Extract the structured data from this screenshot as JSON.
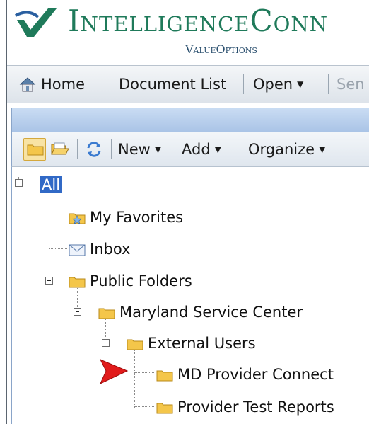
{
  "header": {
    "title": "IntelligenceConn",
    "subtitle": "ValueOptions"
  },
  "toolbar": {
    "home": "Home",
    "document_list": "Document List",
    "open": "Open",
    "send": "Sen"
  },
  "toolbar2": {
    "new": "New",
    "add": "Add",
    "organize": "Organize"
  },
  "tree": {
    "root": "All",
    "items": [
      {
        "label": "My Favorites",
        "icon": "favorites-folder-icon"
      },
      {
        "label": "Inbox",
        "icon": "inbox-envelope-icon"
      },
      {
        "label": "Public Folders",
        "icon": "folder-icon"
      },
      {
        "label": "Maryland Service Center",
        "icon": "folder-icon"
      },
      {
        "label": "External Users",
        "icon": "folder-icon"
      },
      {
        "label": "MD Provider Connect",
        "icon": "folder-icon"
      },
      {
        "label": "Provider Test Reports",
        "icon": "folder-icon"
      }
    ]
  },
  "colors": {
    "brand_green": "#1f7a5a",
    "selection": "#3169c6",
    "arrow": "#e11b1b"
  }
}
